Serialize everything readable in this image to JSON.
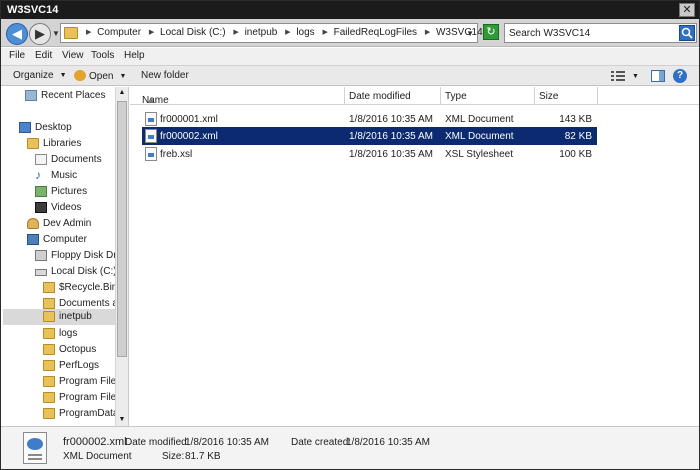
{
  "window": {
    "title": "W3SVC14"
  },
  "address": {
    "crumbs": [
      "Computer",
      "Local Disk (C:)",
      "inetpub",
      "logs",
      "FailedReqLogFiles",
      "W3SVC14"
    ],
    "search_placeholder": "Search W3SVC14"
  },
  "menu": [
    "File",
    "Edit",
    "View",
    "Tools",
    "Help"
  ],
  "commands": {
    "organize": "Organize",
    "open": "Open",
    "new_folder": "New folder"
  },
  "nav": {
    "recent": "Recent Places",
    "desktop": "Desktop",
    "libraries": "Libraries",
    "documents": "Documents",
    "music": "Music",
    "pictures": "Pictures",
    "videos": "Videos",
    "dev_admin": "Dev Admin",
    "computer": "Computer",
    "floppy": "Floppy Disk Drive",
    "local_disk": "Local Disk (C:)",
    "recycle": "$Recycle.Bin",
    "docs_and": "Documents and",
    "inetpub": "inetpub",
    "logs": "logs",
    "octopus": "Octopus",
    "perflogs": "PerfLogs",
    "program_files": "Program Files",
    "program_files_x86": "Program Files (",
    "program_data": "ProgramData"
  },
  "columns": {
    "name": "Name",
    "date": "Date modified",
    "type": "Type",
    "size": "Size"
  },
  "files": [
    {
      "name": "fr000001.xml",
      "date": "1/8/2016 10:35 AM",
      "type": "XML Document",
      "size": "143 KB"
    },
    {
      "name": "fr000002.xml",
      "date": "1/8/2016 10:35 AM",
      "type": "XML Document",
      "size": "82 KB"
    },
    {
      "name": "freb.xsl",
      "date": "1/8/2016 10:35 AM",
      "type": "XSL Stylesheet",
      "size": "100 KB"
    }
  ],
  "details": {
    "filename": "fr000002.xml",
    "modified_label": "Date modified:",
    "modified": "1/8/2016 10:35 AM",
    "created_label": "Date created:",
    "created": "1/8/2016 10:35 AM",
    "type": "XML Document",
    "size_label": "Size:",
    "size": "81.7 KB"
  },
  "colors": {
    "selection": "#0b2a6f",
    "titlebar": "#1b1b1b",
    "folder": "#e8c158"
  }
}
